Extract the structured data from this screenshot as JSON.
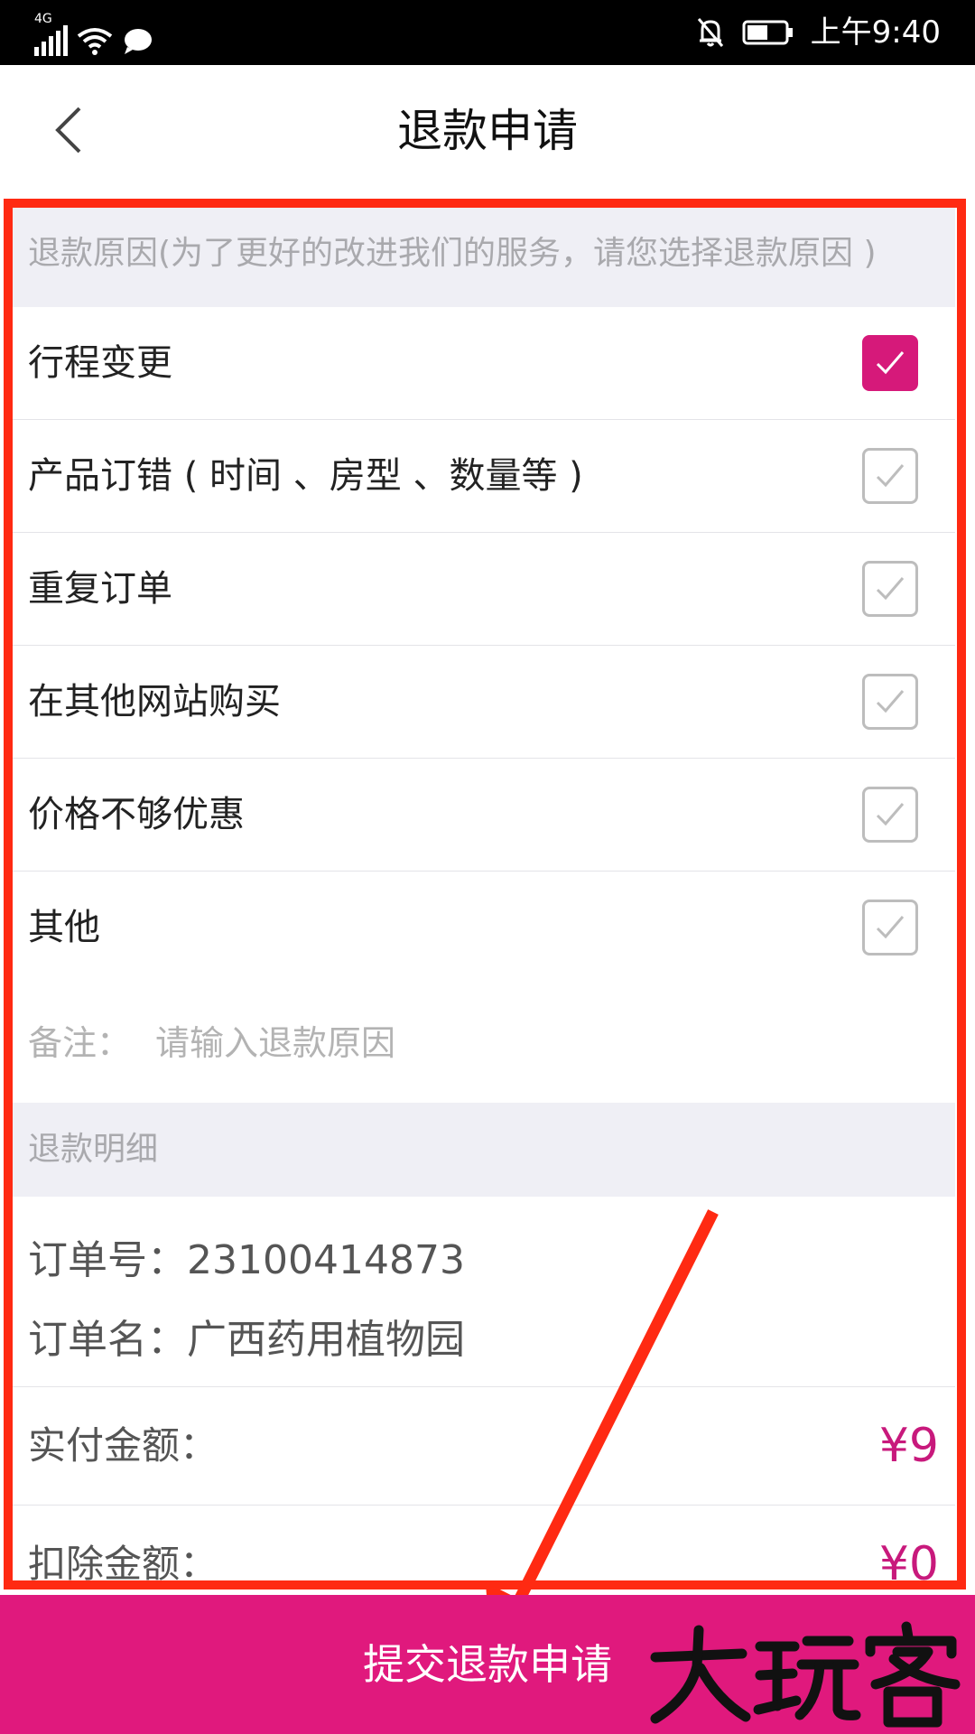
{
  "status_bar": {
    "network": "4G",
    "time": "上午9:40",
    "icons": [
      "signal-icon",
      "wifi-icon",
      "message-icon",
      "bell-off-icon",
      "battery-icon"
    ]
  },
  "nav": {
    "title": "退款申请",
    "back_icon": "chevron-left-icon"
  },
  "reasons": {
    "header": "退款原因(为了更好的改进我们的服务，请您选择退款原因 )",
    "items": [
      {
        "label": "行程变更",
        "checked": true
      },
      {
        "label": "产品订错 ( 时间 、房型 、数量等 )",
        "checked": false
      },
      {
        "label": "重复订单",
        "checked": false
      },
      {
        "label": "在其他网站购买",
        "checked": false
      },
      {
        "label": "价格不够优惠",
        "checked": false
      },
      {
        "label": "其他",
        "checked": false
      }
    ],
    "remark_label": "备注：",
    "remark_placeholder": "请输入退款原因",
    "remark_value": ""
  },
  "details": {
    "header": "退款明细",
    "order_no": "订单号：23100414873",
    "order_name": "订单名：广西药用植物园",
    "paid_label": "实付金额：",
    "paid_value": "¥9",
    "deduct_label": "扣除金额：",
    "deduct_value": "¥0"
  },
  "submit": {
    "label": "提交退款申请"
  },
  "colors": {
    "accent": "#e0197d",
    "price": "#c8197c",
    "annotation": "#ff2a12",
    "section_bg": "#efeff5"
  },
  "watermark_text": "大玩客"
}
